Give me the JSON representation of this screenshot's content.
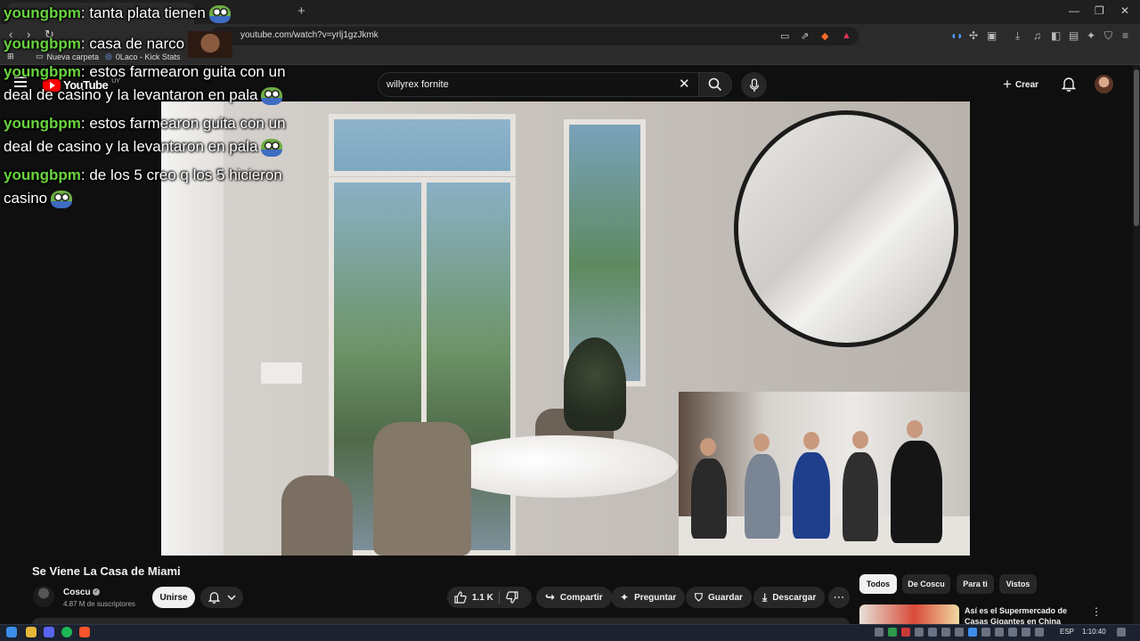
{
  "browser": {
    "url": "youtube.com/watch?v=yrlj1gzJkmk",
    "bookmarks": [
      {
        "label": "Nueva carpeta"
      },
      {
        "label": "0Laco - Kick Stats"
      }
    ],
    "window_controls": {
      "minimize": "—",
      "maximize": "❐",
      "close": "✕"
    },
    "new_tab_glyph": "+"
  },
  "youtube": {
    "logo_text": "YouTube",
    "region_code": "UY",
    "search": {
      "value": "willyrex fornite"
    },
    "create_label": "Crear",
    "icons": {
      "search": "search-icon",
      "mic": "mic-icon",
      "bell": "bell-icon",
      "menu": "hamburger-icon"
    }
  },
  "chat": {
    "messages": [
      {
        "user": "youngbpm",
        "text": ": tanta plata tienen"
      },
      {
        "user": "youngbpm",
        "text": ": casa de narco"
      },
      {
        "user": "youngbpm",
        "text": ": estos farmearon guita con un deal de casino y la levantaron en pala"
      },
      {
        "user": "youngbpm",
        "text": ": estos farmearon guita con un deal de casino y la levantaron en pala"
      },
      {
        "user": "youngbpm",
        "text": ": de los 5 creo q los 5 hicieron casino"
      }
    ]
  },
  "video": {
    "title": "Se Viene La Casa de Miami",
    "channel": {
      "name": "Coscu",
      "subscribers": "4.87 M de suscriptores"
    },
    "join_label": "Unirse",
    "likes": "1.1 K",
    "actions": {
      "share": "Compartir",
      "ask": "Preguntar",
      "save": "Guardar",
      "download": "Descargar"
    }
  },
  "sidebar": {
    "chips": [
      {
        "label": "Todos",
        "active": true
      },
      {
        "label": "De Coscu",
        "active": false
      },
      {
        "label": "Para ti",
        "active": false
      },
      {
        "label": "Vistos",
        "active": false
      }
    ],
    "recommendation": {
      "title": "Así es el Supermercado de Casas Gigantes en China"
    }
  },
  "taskbar": {
    "language": "ESP",
    "time": "1:10:40"
  },
  "colors": {
    "background": "#0f0f0f",
    "chat_username": "#69d43e",
    "youtube_red": "#ff0000",
    "pill_bg": "#272727"
  }
}
